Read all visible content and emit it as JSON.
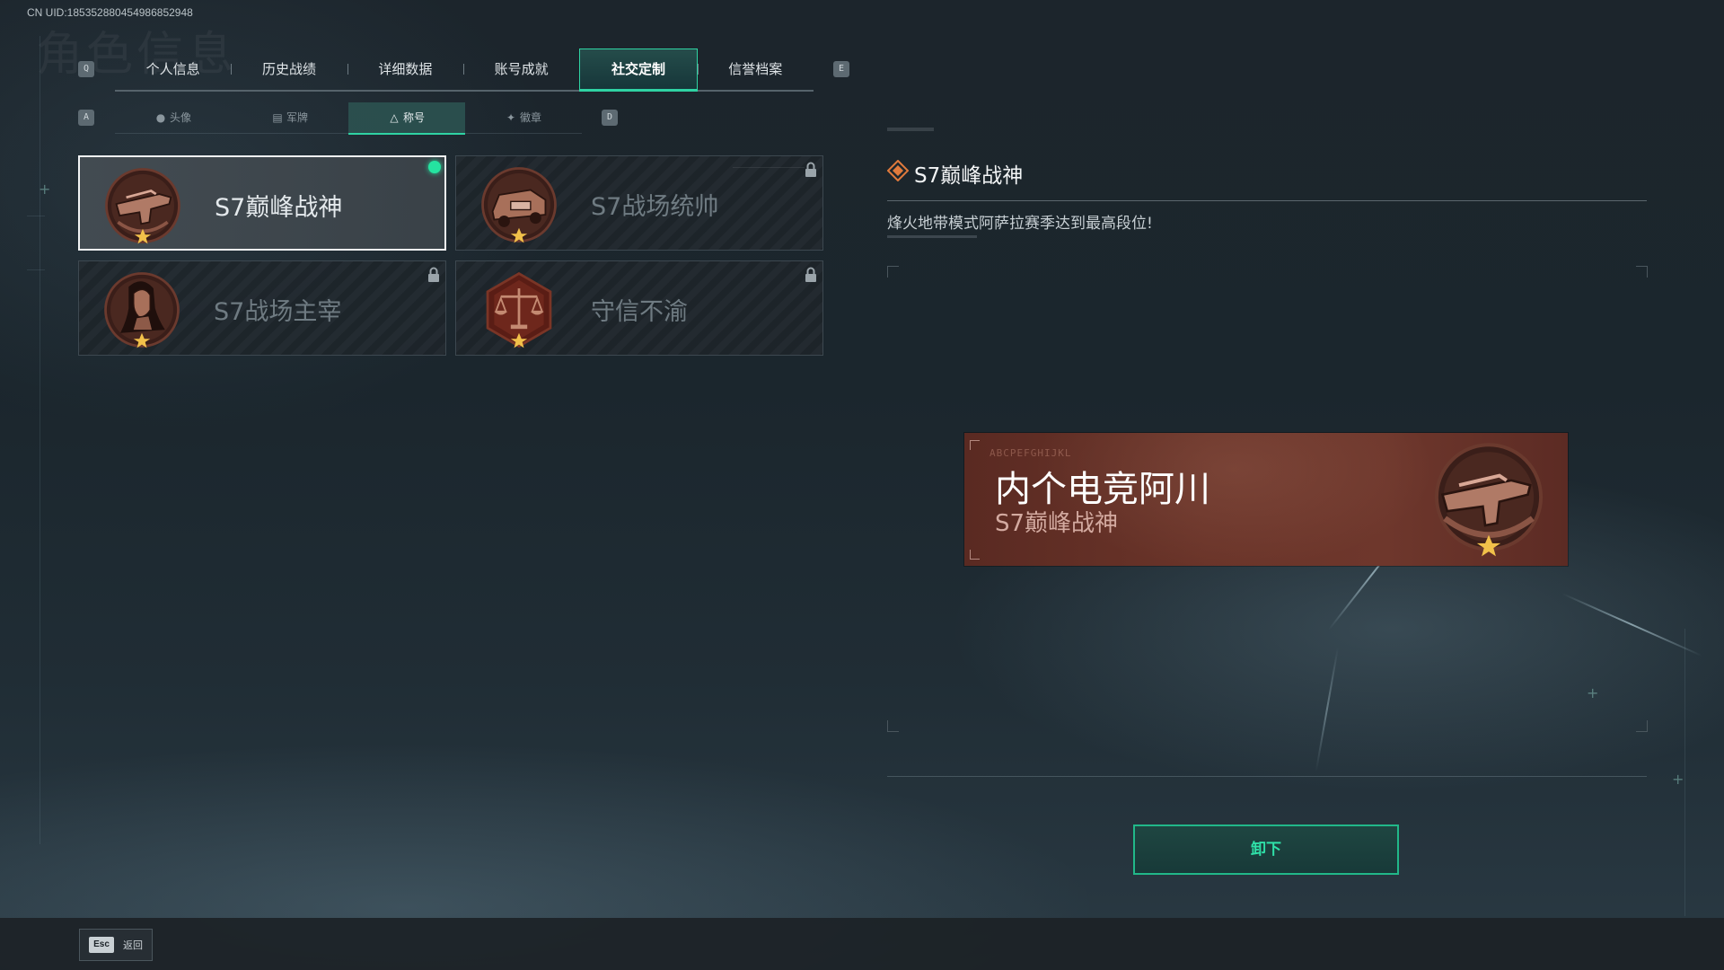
{
  "header": {
    "uid": "CN UID:1853528804549868529​48",
    "ghost_title": "角色信息"
  },
  "tabs": {
    "prev_key": "Q",
    "next_key": "E",
    "items": [
      {
        "label": "个人信息"
      },
      {
        "label": "历史战绩"
      },
      {
        "label": "详细数据"
      },
      {
        "label": "账号成就"
      },
      {
        "label": "社交定制"
      },
      {
        "label": "信誉档案"
      }
    ],
    "active": "社交定制"
  },
  "subtabs": {
    "prev_key": "A",
    "next_key": "D",
    "items": [
      {
        "label": "头像",
        "icon": "person-icon"
      },
      {
        "label": "军牌",
        "icon": "dogtag-icon"
      },
      {
        "label": "称号",
        "icon": "triangle-icon"
      },
      {
        "label": "徽章",
        "icon": "emblem-icon"
      }
    ],
    "active": "称号"
  },
  "titles": [
    {
      "label": "S7巅峰战神",
      "medal": "rifle-medal-icon",
      "selected": true,
      "equipped": true,
      "locked": false
    },
    {
      "label": "S7战场统帅",
      "medal": "vehicle-medal-icon",
      "selected": false,
      "equipped": false,
      "locked": true
    },
    {
      "label": "S7战场主宰",
      "medal": "warrior-medal-icon",
      "selected": false,
      "equipped": false,
      "locked": true
    },
    {
      "label": "守信不渝",
      "medal": "scales-medal-icon",
      "selected": false,
      "equipped": false,
      "locked": true
    }
  ],
  "detail": {
    "title": "S7巅峰战神",
    "description": "烽火地带模式阿萨拉赛季达到最高段位!"
  },
  "preview": {
    "player_name": "内个电竞阿川",
    "title": "S7巅峰战神",
    "runes": "ABCPEFGHIJKL"
  },
  "actions": {
    "unequip_label": "卸下"
  },
  "footer": {
    "back_key": "Esc",
    "back_label": "返回"
  },
  "colors": {
    "accent": "#2fd3a3",
    "equipped_dot": "#25e3a0",
    "banner_bg": "#6a3429",
    "medal_bronze": "#a8705a"
  }
}
